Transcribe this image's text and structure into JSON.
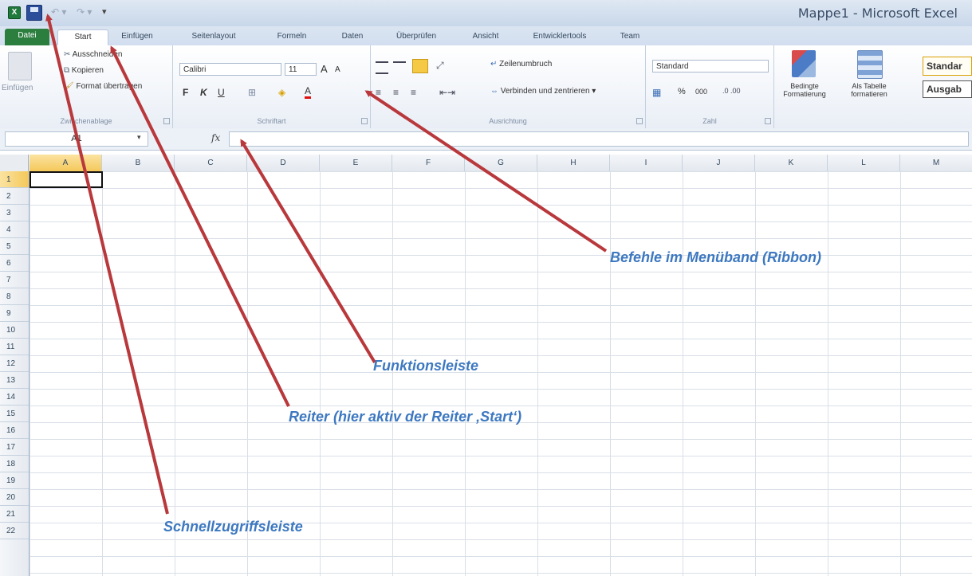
{
  "titlebar": {
    "window_title": "Mappe1  -  Microsoft Excel",
    "app_icon": "excel-icon",
    "quick_access": [
      "save-icon",
      "undo-icon",
      "redo-icon",
      "customize-icon"
    ]
  },
  "tabs": [
    "Datei",
    "Start",
    "Einfügen",
    "Seitenlayout",
    "Formeln",
    "Daten",
    "Überprüfen",
    "Ansicht",
    "Entwicklertools",
    "Team"
  ],
  "ribbon": {
    "clipboard": {
      "paste": "Einfügen",
      "cut": "Ausschneiden",
      "copy": "Kopieren",
      "format_painter": "Format übertragen",
      "label": "Zwischenablage"
    },
    "font": {
      "name": "Calibri",
      "size": "11",
      "grow": "A",
      "shrink": "A",
      "bold": "F",
      "italic": "K",
      "underline": "U",
      "font_color": "A",
      "label": "Schriftart"
    },
    "alignment": {
      "wrap": "Zeilenumbruch",
      "merge": "Verbinden und zentrieren",
      "label": "Ausrichtung"
    },
    "number": {
      "format": "Standard",
      "percent": "%",
      "thousands": "000",
      "label": "Zahl"
    },
    "styles": {
      "conditional_line1": "Bedingte",
      "conditional_line2": "Formatierung",
      "as_table_line1": "Als Tabelle",
      "as_table_line2": "formatieren",
      "style_standard": "Standar",
      "style_output": "Ausgab"
    }
  },
  "formula_bar": {
    "name_box": "A1",
    "fx": "fx",
    "content": ""
  },
  "grid": {
    "columns": [
      "A",
      "B",
      "C",
      "D",
      "E",
      "F",
      "G",
      "H",
      "I",
      "J",
      "K",
      "L",
      "M"
    ],
    "rows": [
      "1",
      "2",
      "3",
      "4",
      "5",
      "6",
      "7",
      "8",
      "9",
      "10",
      "11",
      "12",
      "13",
      "14",
      "15",
      "16",
      "17",
      "18",
      "19",
      "20",
      "21",
      "22"
    ],
    "active_cell": "A1"
  },
  "annotations": {
    "ribbon": "Befehle im Menüband (Ribbon)",
    "formula_bar": "Funktionsleiste",
    "tabs": "Reiter (hier aktiv der Reiter ‚Start‘)",
    "quick_access": "Schnellzugriffsleiste"
  },
  "colors": {
    "arrow": "#b8383c",
    "annotation_text": "#3d78c0",
    "file_tab": "#2c7e3f"
  }
}
